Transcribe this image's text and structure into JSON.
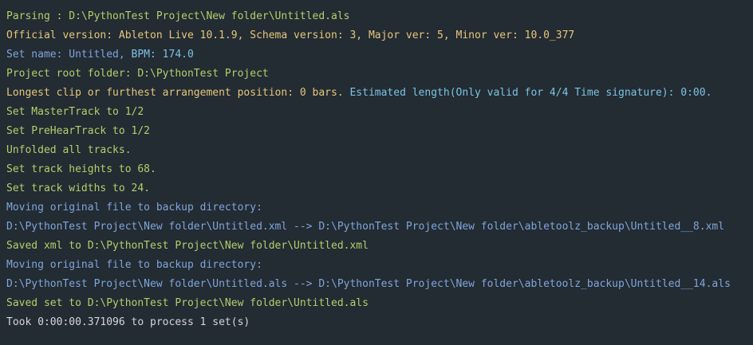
{
  "colors": {
    "background": "#232b33",
    "green": "#b5cf6b",
    "yellow": "#e5c77a",
    "blue": "#7fa6d9",
    "cyan": "#7cc4e3",
    "white": "#d4d7da"
  },
  "lines": [
    {
      "segments": [
        {
          "text": "Parsing : D:\\PythonTest Project\\New folder\\Untitled.als",
          "color": "green"
        }
      ]
    },
    {
      "segments": [
        {
          "text": "Official version: Ableton Live 10.1.9, Schema version: 3, Major ver: 5, Minor ver: 10.0_377",
          "color": "yellow"
        }
      ]
    },
    {
      "segments": [
        {
          "text": "Set name: Untitled, ",
          "color": "blue"
        },
        {
          "text": "BPM: 174.0",
          "color": "cyan"
        }
      ]
    },
    {
      "segments": [
        {
          "text": "Project root folder: D:\\PythonTest Project",
          "color": "green"
        }
      ]
    },
    {
      "segments": [
        {
          "text": "Longest clip or furthest arrangement position: 0 bars. ",
          "color": "yellow"
        },
        {
          "text": "Estimated length(Only valid for 4/4 Time signature): 0:00.",
          "color": "cyan"
        }
      ]
    },
    {
      "segments": [
        {
          "text": "Set MasterTrack to 1/2",
          "color": "green"
        }
      ]
    },
    {
      "segments": [
        {
          "text": "Set PreHearTrack to 1/2",
          "color": "green"
        }
      ]
    },
    {
      "segments": [
        {
          "text": "Unfolded all tracks.",
          "color": "green"
        }
      ]
    },
    {
      "segments": [
        {
          "text": "Set track heights to 68.",
          "color": "green"
        }
      ]
    },
    {
      "segments": [
        {
          "text": "Set track widths to 24.",
          "color": "green"
        }
      ]
    },
    {
      "segments": [
        {
          "text": "Moving original file to backup directory:",
          "color": "blue"
        }
      ]
    },
    {
      "segments": [
        {
          "text": "D:\\PythonTest Project\\New folder\\Untitled.xml --> D:\\PythonTest Project\\New folder\\abletoolz_backup\\Untitled__8.xml",
          "color": "blue"
        }
      ]
    },
    {
      "segments": [
        {
          "text": "Saved xml to D:\\PythonTest Project\\New folder\\Untitled.xml",
          "color": "green"
        }
      ]
    },
    {
      "segments": [
        {
          "text": "Moving original file to backup directory:",
          "color": "blue"
        }
      ]
    },
    {
      "segments": [
        {
          "text": "D:\\PythonTest Project\\New folder\\Untitled.als --> D:\\PythonTest Project\\New folder\\abletoolz_backup\\Untitled__14.als",
          "color": "blue"
        }
      ]
    },
    {
      "segments": [
        {
          "text": "Saved set to D:\\PythonTest Project\\New folder\\Untitled.als",
          "color": "green"
        }
      ]
    },
    {
      "segments": [
        {
          "text": "Took 0:00:00.371096 to process 1 set(s)",
          "color": "white"
        }
      ]
    }
  ]
}
